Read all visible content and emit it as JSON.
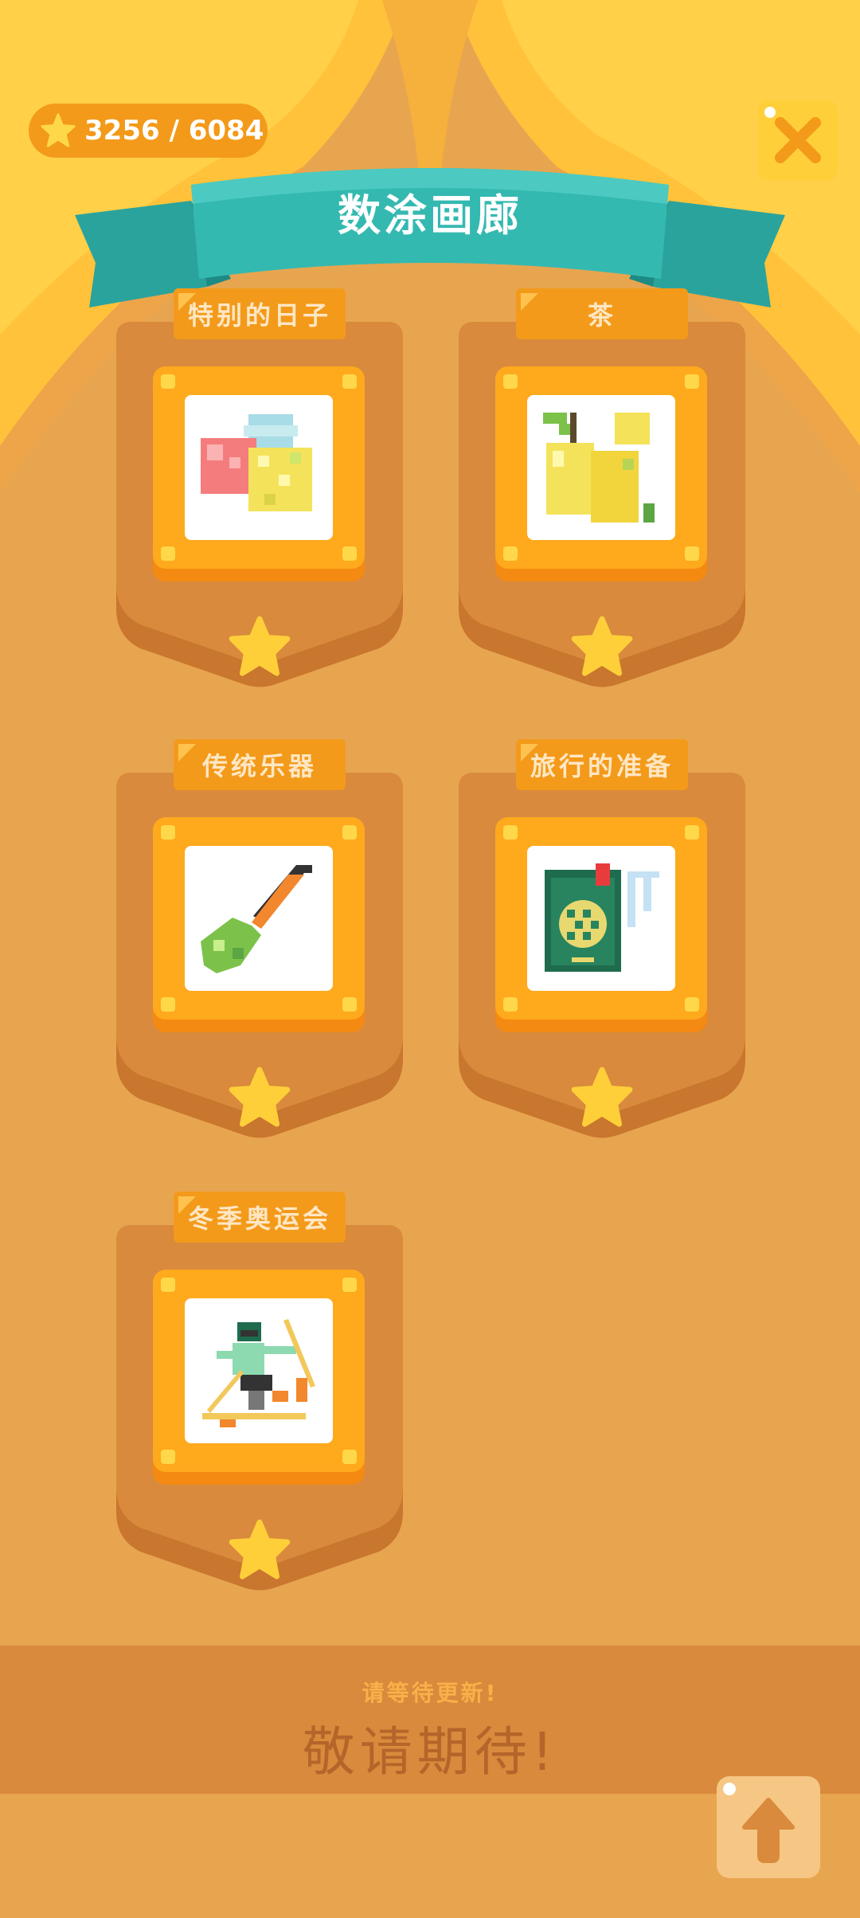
{
  "header": {
    "star_count": "3256 / 6084",
    "title": "数涂画廊"
  },
  "colors": {
    "background": "#E8A550",
    "accent_orange": "#F39A1A",
    "banner_teal": "#2FB3AE",
    "star_yellow": "#FFCF3A"
  },
  "categories": [
    {
      "label": "特别的日子",
      "icon": "fruit-pixel-art-icon"
    },
    {
      "label": "茶",
      "icon": "pear-pixel-art-icon"
    },
    {
      "label": "传统乐器",
      "icon": "instrument-pixel-art-icon"
    },
    {
      "label": "旅行的准备",
      "icon": "passport-pixel-art-icon"
    },
    {
      "label": "冬季奥运会",
      "icon": "skier-pixel-art-icon"
    }
  ],
  "footer": {
    "subtitle": "请等待更新!",
    "message": "敬请期待!"
  },
  "buttons": {
    "close_icon": "close-icon",
    "up_icon": "arrow-up-icon"
  }
}
